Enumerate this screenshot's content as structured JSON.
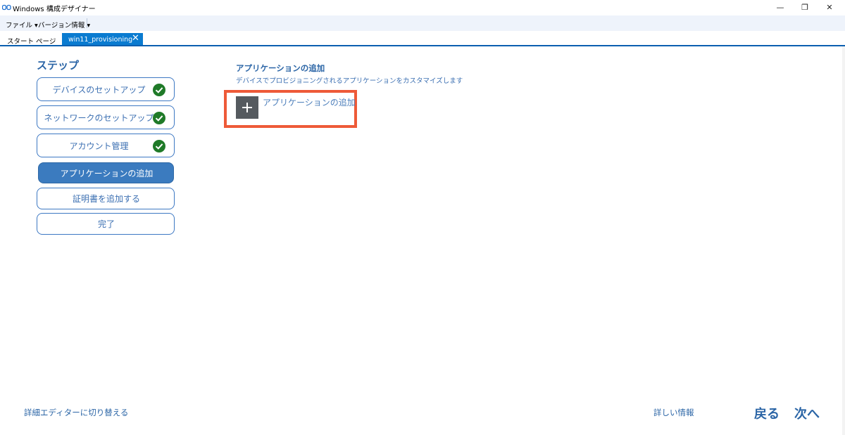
{
  "window": {
    "title": "Windows 構成デザイナー",
    "controls": {
      "minimize": "—",
      "restore": "❐",
      "close": "✕"
    }
  },
  "menu": {
    "items": [
      {
        "label": "ファイル ▾"
      },
      {
        "label": "バージョン情報 ▾"
      }
    ]
  },
  "tabs": {
    "start_page": "スタート ページ",
    "active": "win11_provisioning",
    "close_glyph": "✕"
  },
  "steps": {
    "title": "ステップ",
    "items": [
      {
        "label": "デバイスのセットアップ",
        "state": "done"
      },
      {
        "label": "ネットワークのセットアップ",
        "state": "done"
      },
      {
        "label": "アカウント管理",
        "state": "done"
      },
      {
        "label": "アプリケーションの追加",
        "state": "active"
      },
      {
        "label": "証明書を追加する",
        "state": "pending"
      },
      {
        "label": "完了",
        "state": "pending"
      }
    ]
  },
  "main": {
    "title": "アプリケーションの追加",
    "subtitle": "デバイスでプロビジョニングされるアプリケーションをカスタマイズします",
    "add_button_label": "アプリケーションの追加",
    "add_icon": "plus-icon"
  },
  "footer": {
    "switch_editor": "詳細エディターに切り替える",
    "more_info": "詳しい情報",
    "back": "戻る",
    "next": "次へ"
  },
  "colors": {
    "accent": "#2b65a6",
    "tab_active": "#0a7bd0",
    "check_green": "#1f7a28",
    "highlight": "#ee5a38",
    "active_step": "#3b7bbf"
  }
}
